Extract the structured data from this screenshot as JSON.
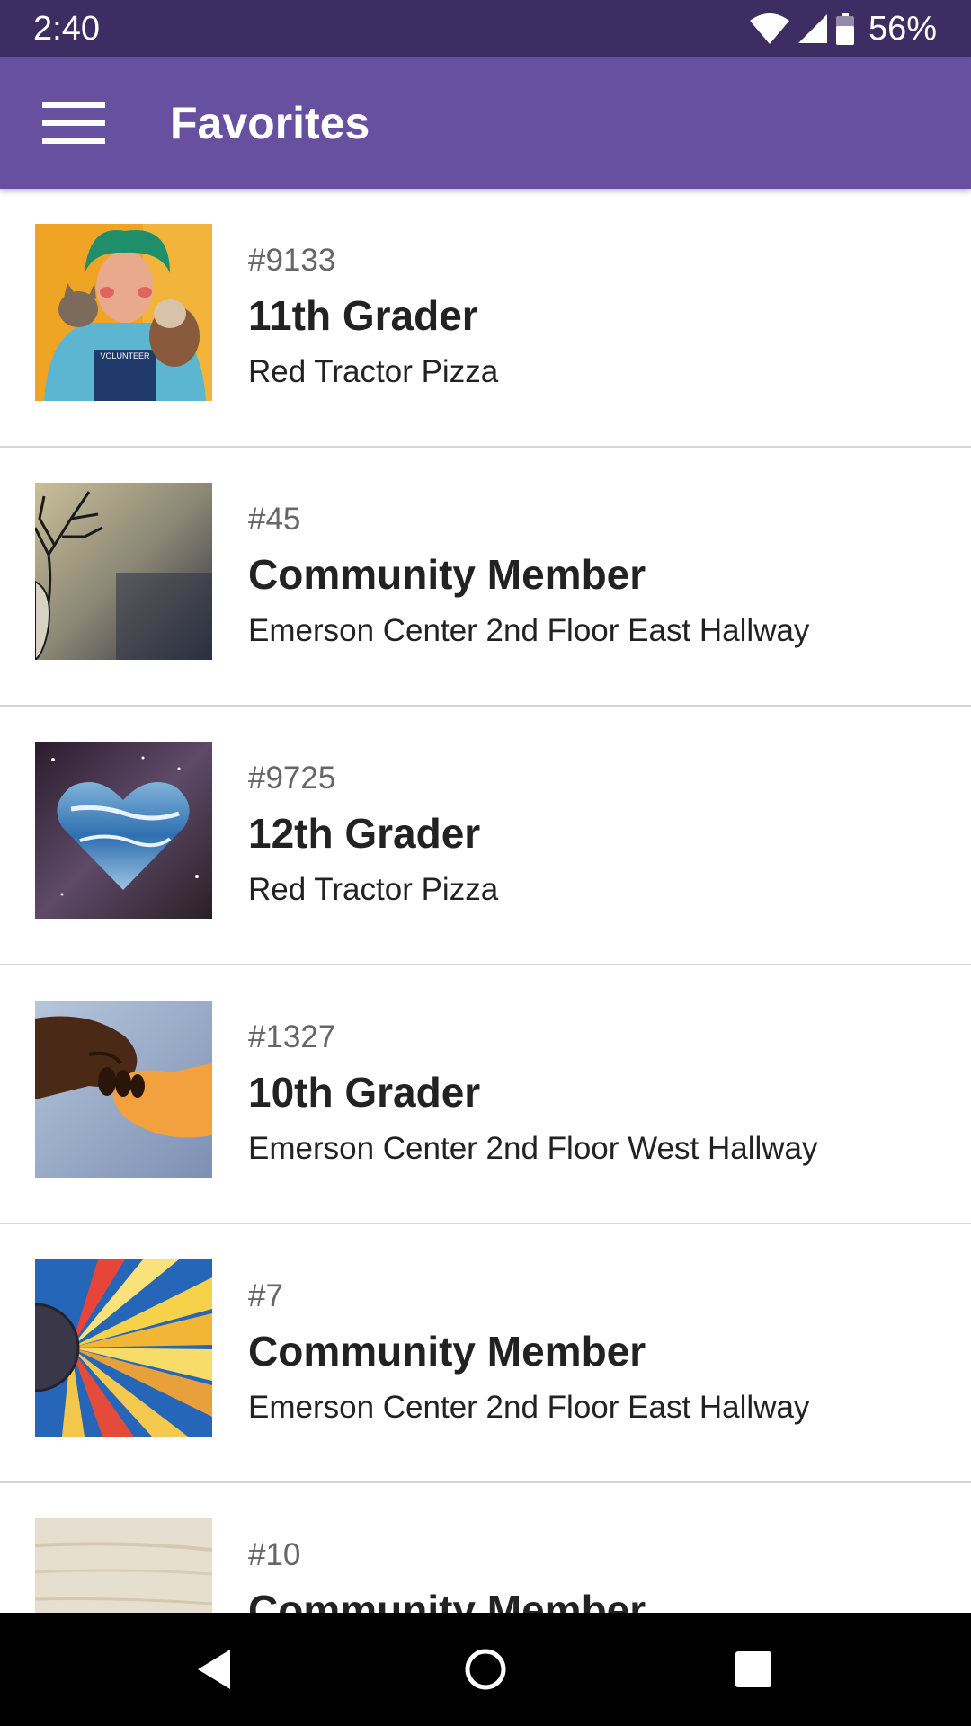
{
  "status_bar": {
    "time": "2:40",
    "battery_percent": "56%",
    "icons": [
      "wifi-icon",
      "cell-signal-icon",
      "battery-icon"
    ]
  },
  "app_bar": {
    "title": "Favorites",
    "menu_icon": "hamburger-menu-icon"
  },
  "colors": {
    "status_bar": "#3d2d63",
    "app_bar": "#67509f",
    "divider": "#d6d6d6"
  },
  "favorites": [
    {
      "id": "#9133",
      "title": "11th Grader",
      "location": "Red Tractor Pizza",
      "thumbnail": "artwork-green-haired-volunteer",
      "thumbnail_text": "VOLUNTEER"
    },
    {
      "id": "#45",
      "title": "Community Member",
      "location": "Emerson Center 2nd Floor East Hallway",
      "thumbnail": "artwork-deer-antlers"
    },
    {
      "id": "#9725",
      "title": "12th Grader",
      "location": "Red Tractor Pizza",
      "thumbnail": "artwork-blue-heart-galaxy"
    },
    {
      "id": "#1327",
      "title": "10th Grader",
      "location": "Emerson Center 2nd Floor West Hallway",
      "thumbnail": "artwork-holding-hands"
    },
    {
      "id": "#7",
      "title": "Community Member",
      "location": "Emerson Center 2nd Floor East Hallway",
      "thumbnail": "artwork-sunflower"
    },
    {
      "id": "#10",
      "title": "Community Member",
      "location": "",
      "thumbnail": "artwork-wood-panel"
    }
  ],
  "nav_bar": {
    "back": "back-icon",
    "home": "home-icon",
    "recents": "recents-icon"
  }
}
